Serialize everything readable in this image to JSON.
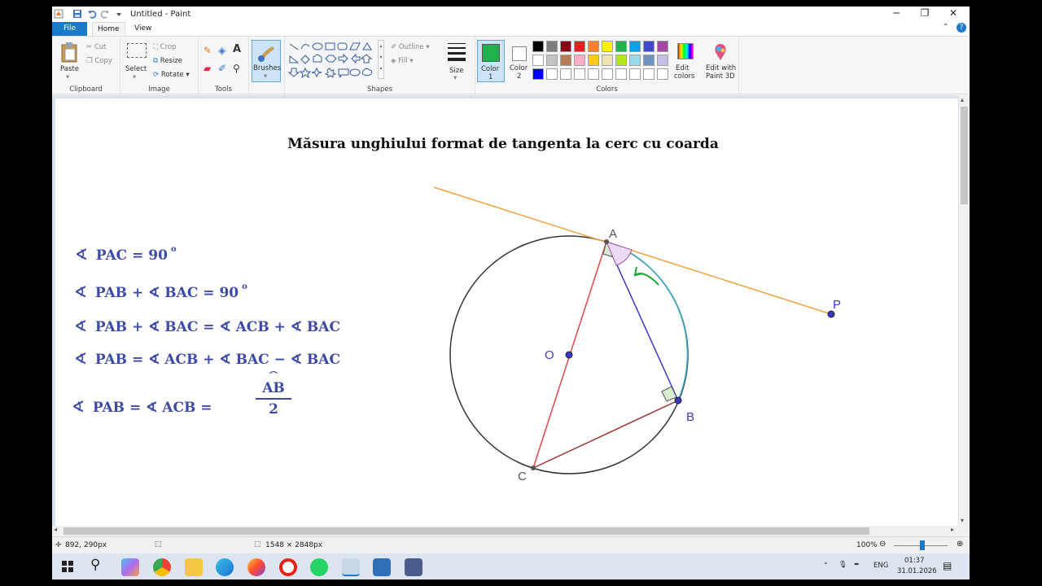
{
  "window": {
    "title": "Untitled - Paint"
  },
  "tabs": {
    "file": "File",
    "home": "Home",
    "view": "View"
  },
  "ribbon": {
    "clipboard": {
      "label": "Clipboard",
      "paste": "Paste",
      "cut": "Cut",
      "copy": "Copy"
    },
    "image": {
      "label": "Image",
      "select": "Select",
      "crop": "Crop",
      "resize": "Resize",
      "rotate": "Rotate"
    },
    "tools": {
      "label": "Tools"
    },
    "brushes": {
      "label": "Brushes"
    },
    "shapes": {
      "label": "Shapes",
      "outline": "Outline",
      "fill": "Fill"
    },
    "size": {
      "label": "Size"
    },
    "color1": {
      "label1": "Color",
      "label2": "1",
      "value": "#22b14c"
    },
    "color2": {
      "label1": "Color",
      "label2": "2",
      "value": "#ffffff"
    },
    "colors": {
      "label": "Colors",
      "edit1": "Edit",
      "edit2": "colors"
    },
    "paint3d": {
      "label1": "Edit with",
      "label2": "Paint 3D"
    },
    "palette_row1": [
      "#000000",
      "#7f7f7f",
      "#880015",
      "#ed1c24",
      "#ff7f27",
      "#fff200",
      "#22b14c",
      "#00a2e8",
      "#3f48cc",
      "#a349a4"
    ],
    "palette_row2": [
      "#ffffff",
      "#c3c3c3",
      "#b97a57",
      "#ffaec9",
      "#ffc90e",
      "#efe4b0",
      "#b5e61d",
      "#99d9ea",
      "#7092be",
      "#c8bfe7"
    ],
    "palette_row3": [
      "#0000ff",
      "#ffffff",
      "#ffffff",
      "#ffffff",
      "#ffffff",
      "#ffffff",
      "#ffffff",
      "#ffffff",
      "#ffffff",
      "#ffffff"
    ]
  },
  "canvas": {
    "heading": "Măsura unghiului format de tangenta la cerc cu coarda",
    "formulas": {
      "f1": "PAC = 90",
      "f1_deg": "o",
      "f2": "PAB + ∢ BAC = 90",
      "f2_deg": "o",
      "f3": "PAB + ∢ BAC = ∢ ACB + ∢ BAC",
      "f4": "PAB = ∢ ACB + ∢ BAC − ∢ BAC",
      "f5a": "PAB = ∢ ACB =",
      "f5_num": "AB",
      "f5_den": "2",
      "angle_symbol": "∢"
    },
    "points": {
      "A": "A",
      "B": "B",
      "C": "C",
      "O": "O",
      "P": "P"
    },
    "colors": {
      "tangent": "#f0a33c",
      "chord_ab": "#3a38c4",
      "diameter": "#e0474c",
      "chord_cb": "#9b3030",
      "circle": "#333333",
      "arc": "#38a8c8",
      "arrow": "#1fa43a"
    }
  },
  "status": {
    "cursor": "892, 290px",
    "size": "1548 × 2848px",
    "zoom": "100%"
  },
  "taskbar": {
    "lang": "ENG",
    "time": "01:37",
    "date": "31.01.2026"
  }
}
